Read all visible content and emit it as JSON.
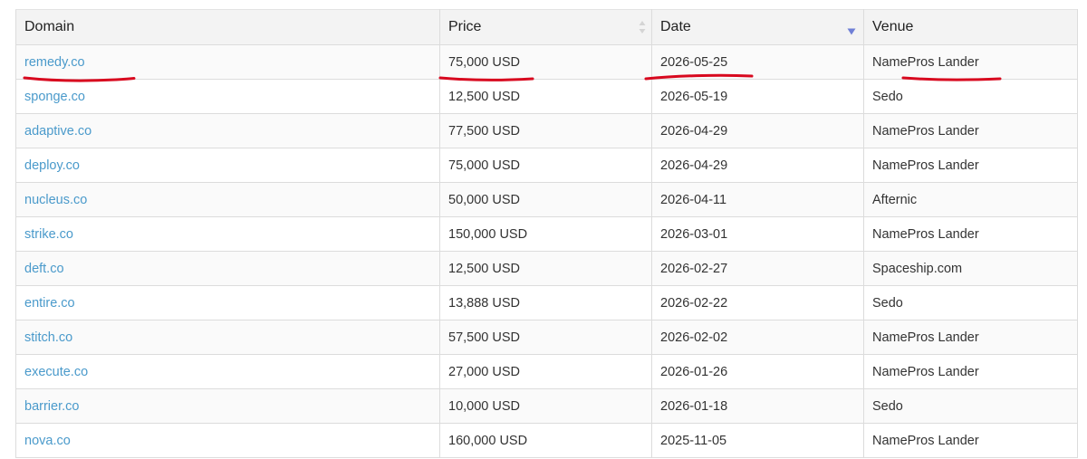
{
  "table": {
    "columns": [
      {
        "label": "Domain"
      },
      {
        "label": "Price",
        "sort": "none"
      },
      {
        "label": "Date",
        "sort": "desc"
      },
      {
        "label": "Venue"
      }
    ],
    "rows": [
      {
        "domain": "remedy.co",
        "price": "75,000 USD",
        "date": "2026-05-25",
        "venue": "NamePros Lander"
      },
      {
        "domain": "sponge.co",
        "price": "12,500 USD",
        "date": "2026-05-19",
        "venue": "Sedo"
      },
      {
        "domain": "adaptive.co",
        "price": "77,500 USD",
        "date": "2026-04-29",
        "venue": "NamePros Lander"
      },
      {
        "domain": "deploy.co",
        "price": "75,000 USD",
        "date": "2026-04-29",
        "venue": "NamePros Lander"
      },
      {
        "domain": "nucleus.co",
        "price": "50,000 USD",
        "date": "2026-04-11",
        "venue": "Afternic"
      },
      {
        "domain": "strike.co",
        "price": "150,000 USD",
        "date": "2026-03-01",
        "venue": "NamePros Lander"
      },
      {
        "domain": "deft.co",
        "price": "12,500 USD",
        "date": "2026-02-27",
        "venue": "Spaceship.com"
      },
      {
        "domain": "entire.co",
        "price": "13,888 USD",
        "date": "2026-02-22",
        "venue": "Sedo"
      },
      {
        "domain": "stitch.co",
        "price": "57,500 USD",
        "date": "2026-02-02",
        "venue": "NamePros Lander"
      },
      {
        "domain": "execute.co",
        "price": "27,000 USD",
        "date": "2026-01-26",
        "venue": "NamePros Lander"
      },
      {
        "domain": "barrier.co",
        "price": "10,000 USD",
        "date": "2026-01-18",
        "venue": "Sedo"
      },
      {
        "domain": "nova.co",
        "price": "160,000 USD",
        "date": "2025-11-05",
        "venue": "NamePros Lander"
      }
    ]
  },
  "annotation": {
    "color": "#d8091f",
    "highlighted_row": "remedy.co"
  },
  "colors": {
    "link": "#4a9acb",
    "header_bg": "#f3f3f3",
    "border": "#dcdcdc",
    "sort_icon_active": "#6f7fd6"
  }
}
